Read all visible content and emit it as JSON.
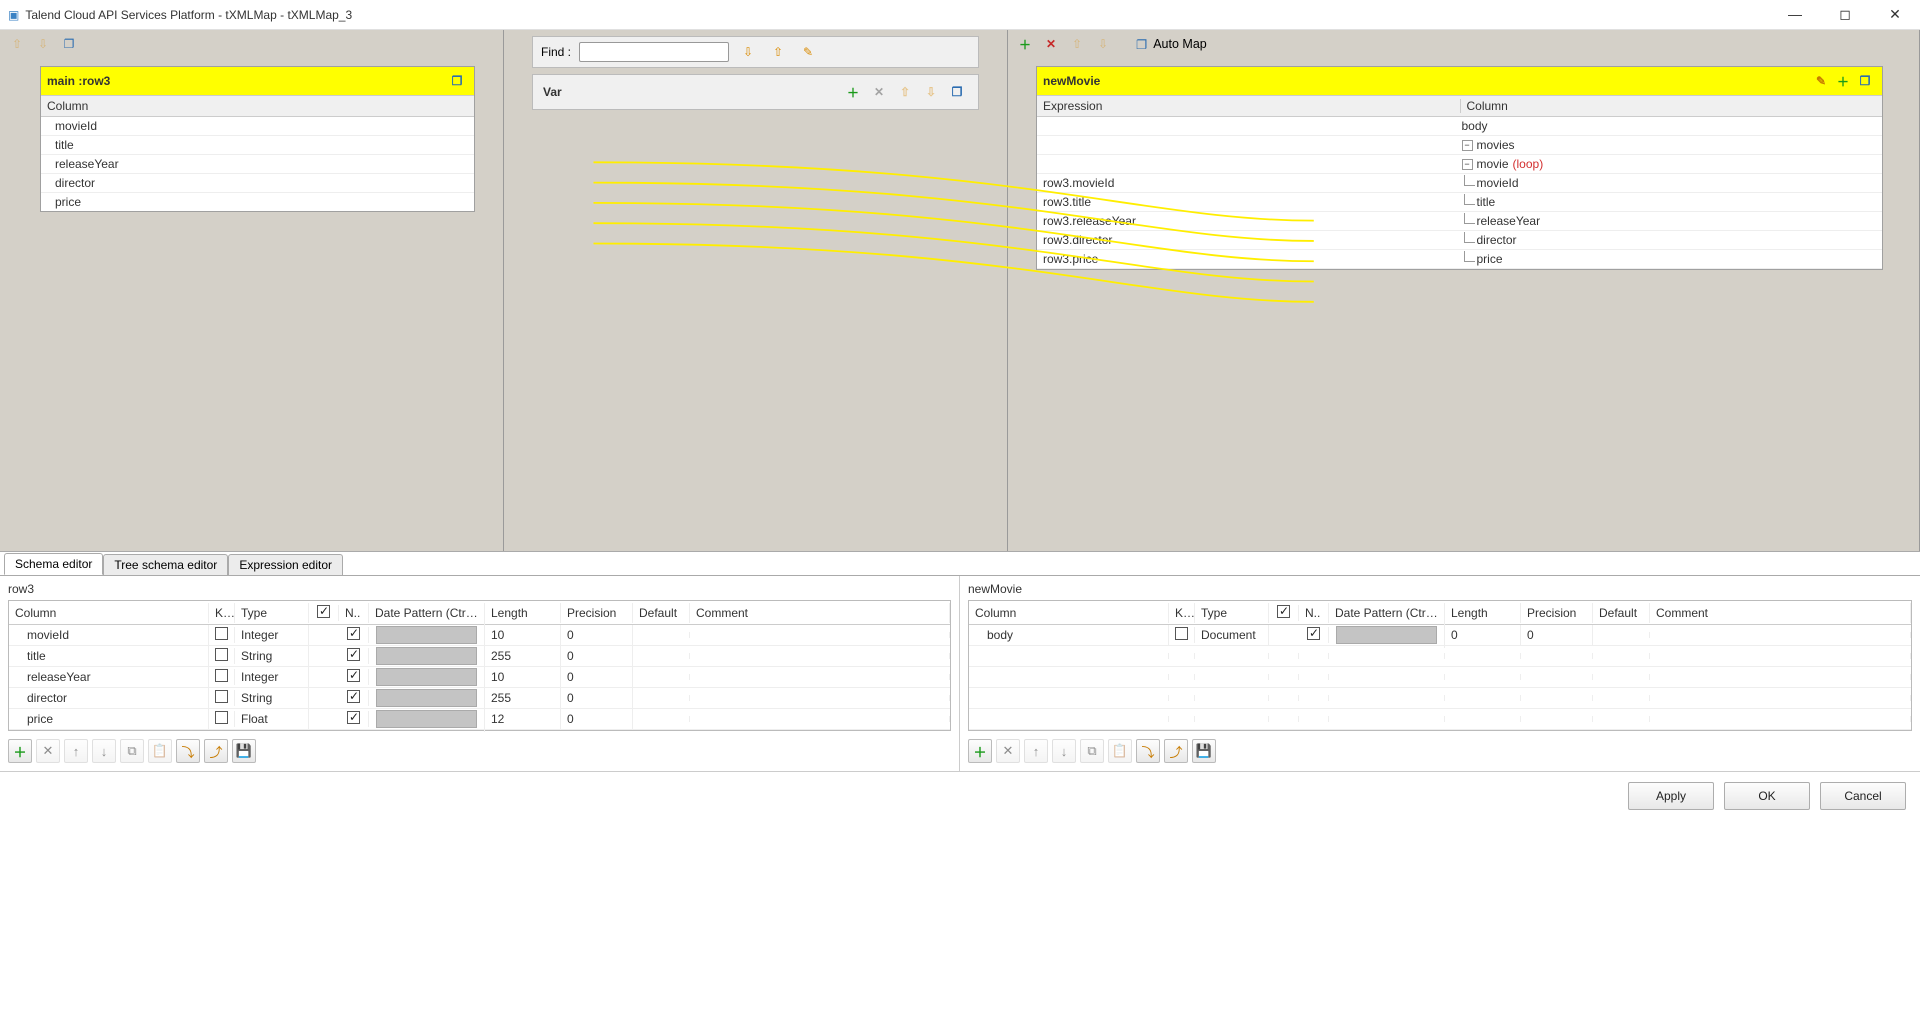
{
  "window": {
    "title": "Talend Cloud API Services Platform - tXMLMap - tXMLMap_3"
  },
  "input_card": {
    "title": "main :row3",
    "header": "Column",
    "rows": [
      "movieId",
      "title",
      "releaseYear",
      "director",
      "price"
    ]
  },
  "find": {
    "label": "Find :",
    "value": ""
  },
  "var": {
    "label": "Var"
  },
  "output_toolbar": {
    "auto_map": "Auto Map"
  },
  "output_card": {
    "title": "newMovie",
    "headers": {
      "expression": "Expression",
      "column": "Column"
    },
    "tree": [
      {
        "expr": "",
        "col": "body",
        "indent": 0,
        "node": "leaf-open"
      },
      {
        "expr": "",
        "col": "movies",
        "indent": 1,
        "node": "minus"
      },
      {
        "expr": "",
        "col": "movie",
        "loop": "(loop)",
        "indent": 2,
        "node": "minus"
      },
      {
        "expr": "row3.movieId",
        "col": "movieId",
        "indent": 3,
        "node": "leaf"
      },
      {
        "expr": "row3.title",
        "col": "title",
        "indent": 3,
        "node": "leaf"
      },
      {
        "expr": "row3.releaseYear",
        "col": "releaseYear",
        "indent": 3,
        "node": "leaf"
      },
      {
        "expr": "row3.director",
        "col": "director",
        "indent": 3,
        "node": "leaf"
      },
      {
        "expr": "row3.price",
        "col": "price",
        "indent": 3,
        "node": "leaf"
      }
    ]
  },
  "tabs": {
    "schema_editor": "Schema editor",
    "tree_schema_editor": "Tree schema editor",
    "expression_editor": "Expression editor"
  },
  "lower_left": {
    "title": "row3",
    "columns": {
      "column": "Column",
      "key": "K...",
      "type": "Type",
      "chk": "✓",
      "n": "N..",
      "date": "Date Pattern (Ctrl+...",
      "length": "Length",
      "precision": "Precision",
      "default": "Default",
      "comment": "Comment"
    },
    "rows": [
      {
        "column": "movieId",
        "key": false,
        "type": "Integer",
        "n": true,
        "length": "10",
        "precision": "0",
        "default": "",
        "comment": ""
      },
      {
        "column": "title",
        "key": false,
        "type": "String",
        "n": true,
        "length": "255",
        "precision": "0",
        "default": "",
        "comment": ""
      },
      {
        "column": "releaseYear",
        "key": false,
        "type": "Integer",
        "n": true,
        "length": "10",
        "precision": "0",
        "default": "",
        "comment": ""
      },
      {
        "column": "director",
        "key": false,
        "type": "String",
        "n": true,
        "length": "255",
        "precision": "0",
        "default": "",
        "comment": ""
      },
      {
        "column": "price",
        "key": false,
        "type": "Float",
        "n": true,
        "length": "12",
        "precision": "0",
        "default": "",
        "comment": ""
      }
    ]
  },
  "lower_right": {
    "title": "newMovie",
    "columns": {
      "column": "Column",
      "key": "K...",
      "type": "Type",
      "chk": "✓",
      "n": "N..",
      "date": "Date Pattern (Ctrl+...",
      "length": "Length",
      "precision": "Precision",
      "default": "Default",
      "comment": "Comment"
    },
    "rows": [
      {
        "column": "body",
        "key": false,
        "type": "Document",
        "n": true,
        "length": "0",
        "precision": "0",
        "default": "",
        "comment": ""
      }
    ]
  },
  "footer": {
    "apply": "Apply",
    "ok": "OK",
    "cancel": "Cancel"
  }
}
